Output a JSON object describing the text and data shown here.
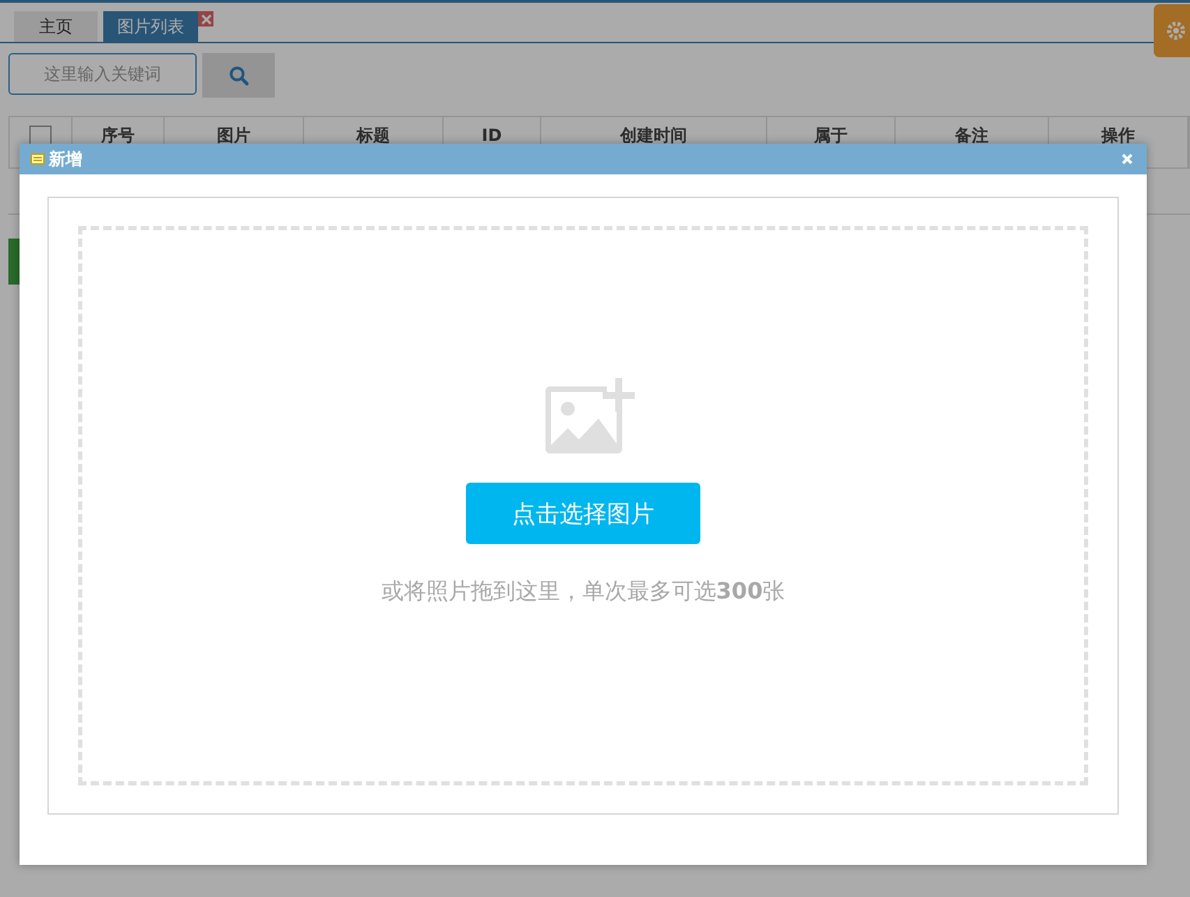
{
  "tabs": [
    {
      "label": "主页",
      "selected": false,
      "closable": false
    },
    {
      "label": "图片列表",
      "selected": true,
      "closable": true
    }
  ],
  "search": {
    "placeholder": "这里输入关键词"
  },
  "table": {
    "select_all": {
      "checked": false
    },
    "columns": [
      "序号",
      "图片",
      "标题",
      "ID",
      "创建时间",
      "属于",
      "备注",
      "操作"
    ]
  },
  "dialog": {
    "title": "新增",
    "upload": {
      "button": "点击选择图片",
      "hint": "或将照片拖到这里，单次最多可选**300**张"
    }
  }
}
